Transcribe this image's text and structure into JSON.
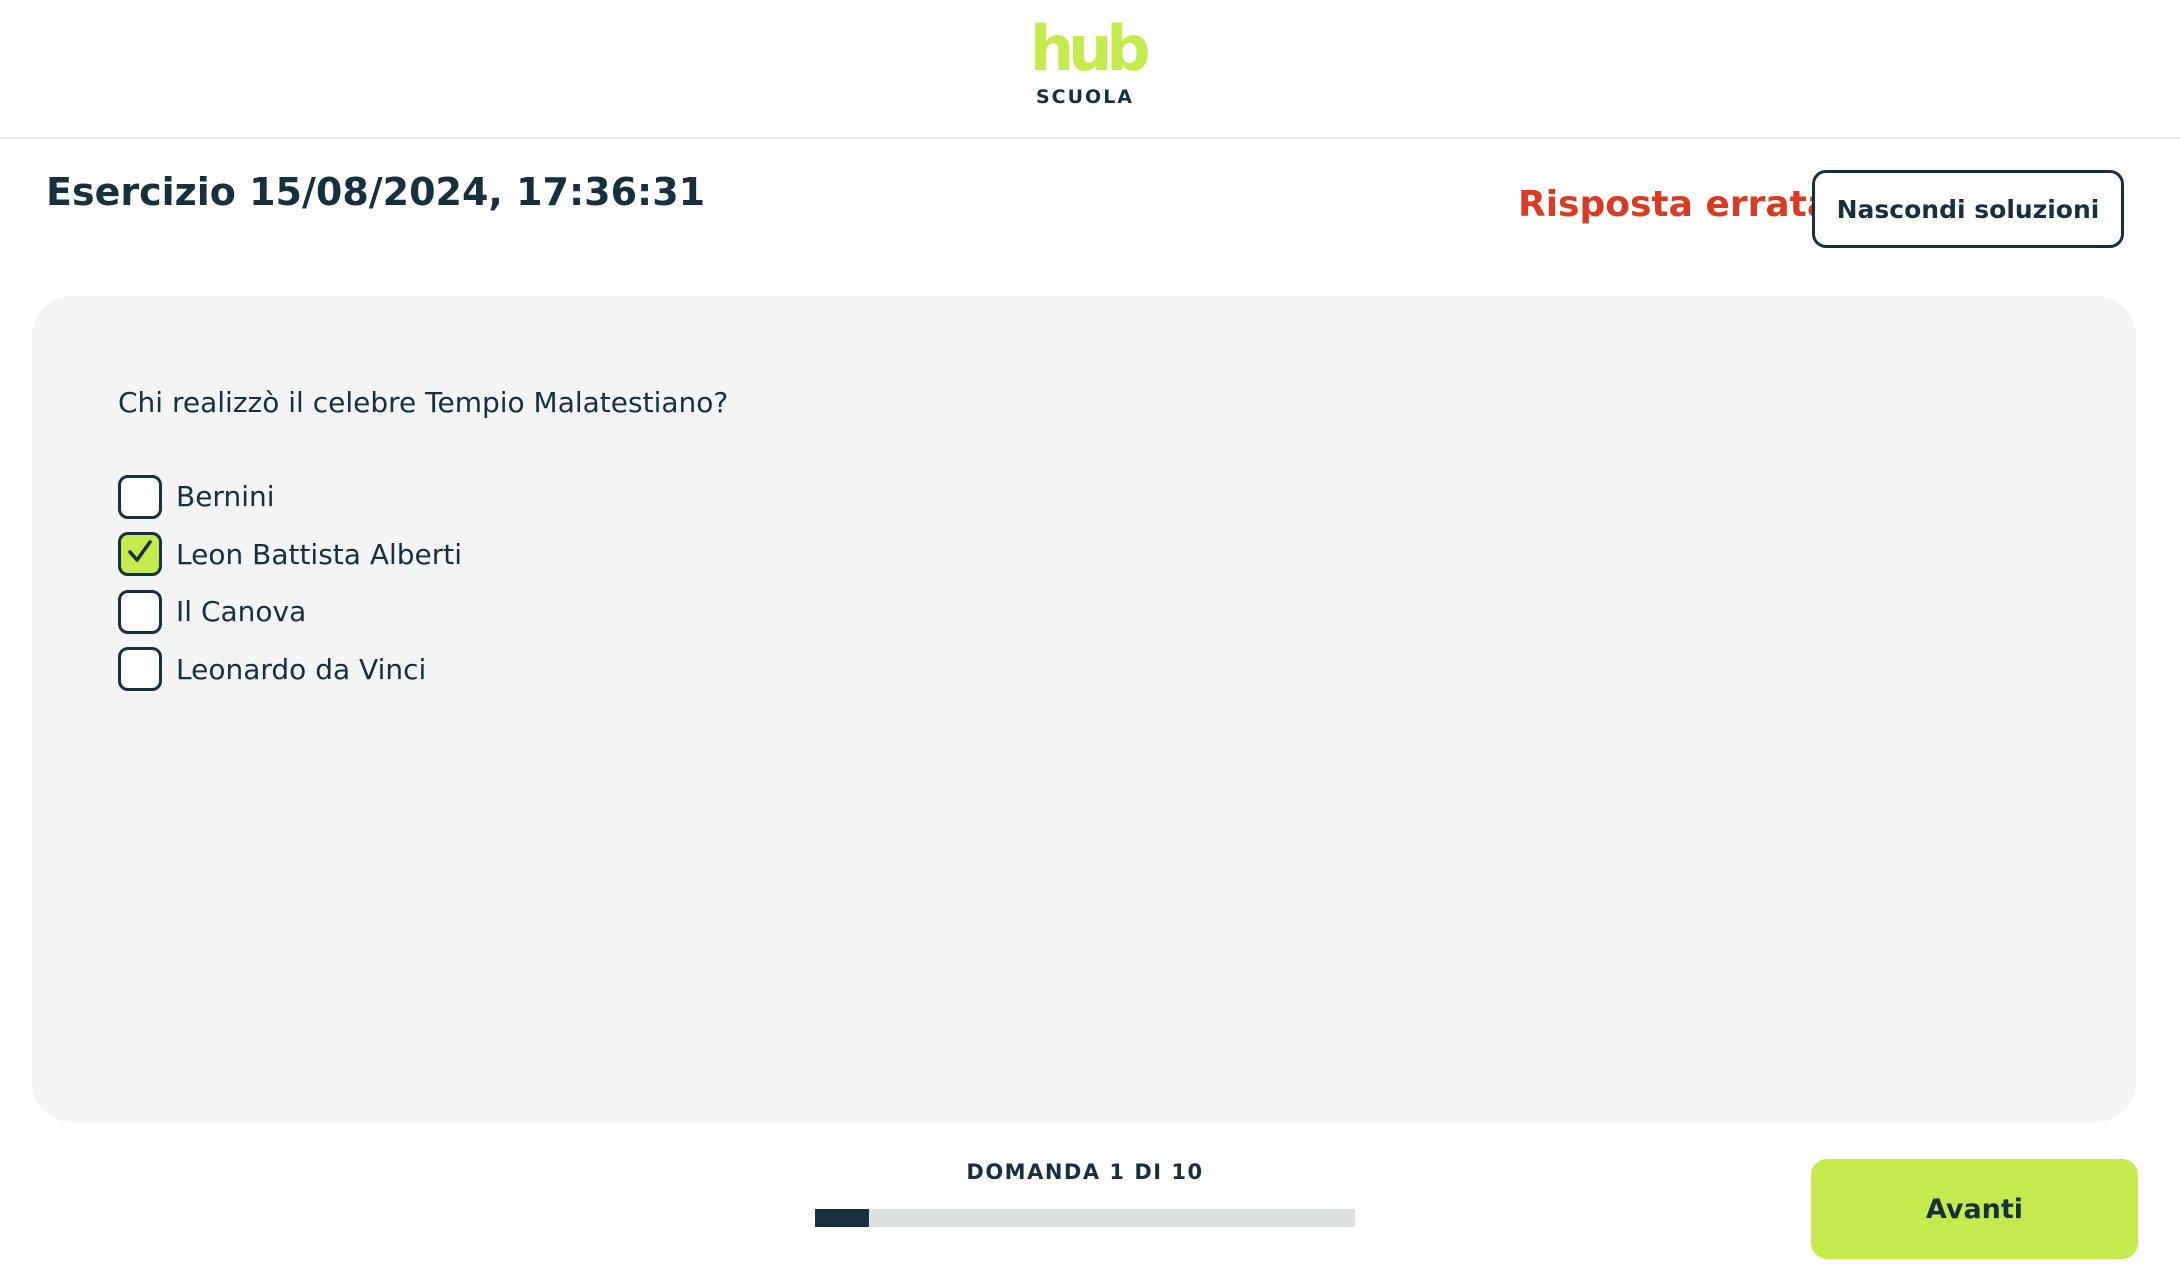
{
  "logo": {
    "mark": "hub",
    "subtitle": "SCUOLA",
    "accent_color": "#c4ea4d"
  },
  "exercise": {
    "title": "Esercizio 15/08/2024, 17:36:31",
    "result_status": "Risposta errata",
    "result_color": "#d83a22",
    "toggle_solutions_label": "Nascondi soluzioni"
  },
  "question": {
    "text": "Chi realizzò il celebre Tempio Malatestiano?",
    "options": [
      {
        "label": "Bernini",
        "checked": false
      },
      {
        "label": "Leon Battista Alberti",
        "checked": true
      },
      {
        "label": "Il Canova",
        "checked": false
      },
      {
        "label": "Leonardo da Vinci",
        "checked": false
      }
    ],
    "checkbox_icon": "check-icon"
  },
  "footer": {
    "progress_label": "DOMANDA 1 DI 10",
    "current_question": 1,
    "total_questions": 10,
    "progress_fraction": 0.1,
    "next_label": "Avanti"
  }
}
